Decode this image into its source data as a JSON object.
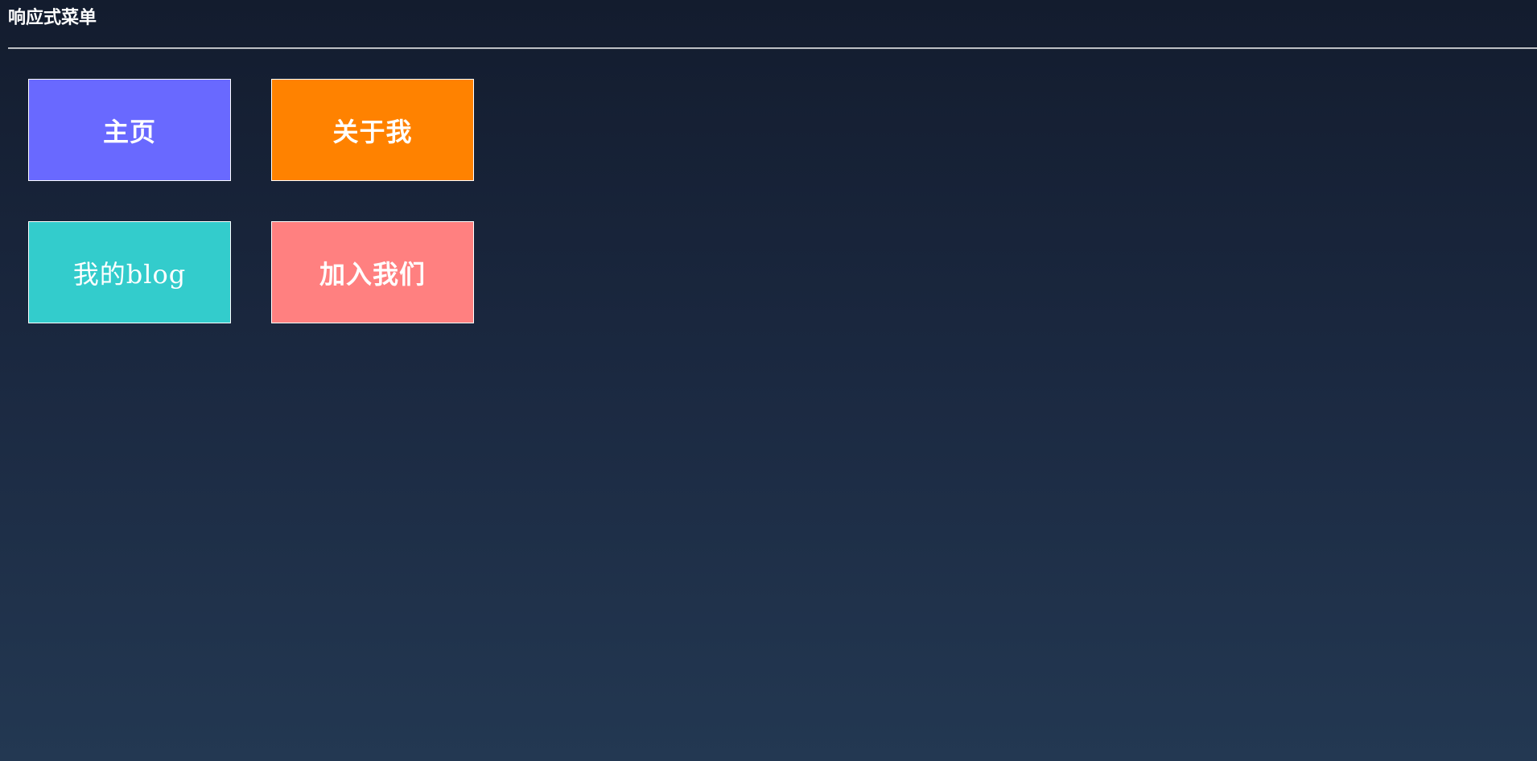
{
  "page": {
    "title": "响应式菜单"
  },
  "menu": {
    "items": [
      {
        "label": "主页",
        "color": "#6969ff"
      },
      {
        "label": "关于我",
        "color": "#ff8200"
      },
      {
        "label": "我的blog",
        "color": "#33cccc"
      },
      {
        "label": "加入我们",
        "color": "#ff8080"
      }
    ]
  }
}
